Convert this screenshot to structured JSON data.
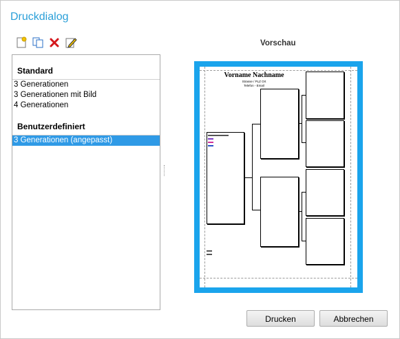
{
  "window": {
    "title": "Druckdialog"
  },
  "toolbar": {
    "buttons": [
      {
        "name": "new-template-icon",
        "color": "#f2c200"
      },
      {
        "name": "copy-template-icon",
        "color": "#2a6fc7"
      },
      {
        "name": "delete-icon",
        "color": "#d4161b"
      },
      {
        "name": "edit-icon",
        "color": "#333333"
      }
    ]
  },
  "templates": {
    "standard_header": "Standard",
    "standard_items": [
      "3 Generationen",
      "3 Generationen mit Bild",
      "4 Generationen"
    ],
    "custom_header": "Benutzerdefiniert",
    "custom_items": [
      "3 Generationen (angepasst)"
    ],
    "selected": "3 Generationen (angepasst)"
  },
  "preview": {
    "label": "Vorschau",
    "name": "Vorname Nachname",
    "address": "Strasse / PLZ Ort",
    "contact": "Telefon - Email",
    "border_color": "#1aa4ec"
  },
  "buttons": {
    "print": "Drucken",
    "cancel": "Abbrechen"
  },
  "colors": {
    "accent": "#2a9fd8",
    "selection": "#2f9ae6"
  }
}
